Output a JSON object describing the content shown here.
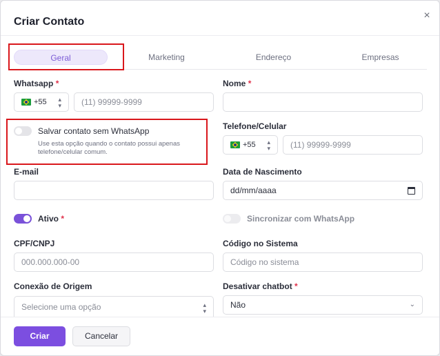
{
  "modal": {
    "title": "Criar Contato",
    "close_icon": "×"
  },
  "tabs": [
    {
      "label": "Geral",
      "active": true
    },
    {
      "label": "Marketing"
    },
    {
      "label": "Endereço"
    },
    {
      "label": "Empresas"
    }
  ],
  "form": {
    "whatsapp": {
      "label": "Whatsapp",
      "required": "*",
      "country_code": "+55",
      "placeholder": "(11) 99999-9999"
    },
    "nome": {
      "label": "Nome",
      "required": "*",
      "value": ""
    },
    "save_without_whatsapp": {
      "label": "Salvar contato sem WhatsApp",
      "help": "Use esta opção quando o contato possui apenas telefone/celular comum.",
      "enabled": false
    },
    "telefone": {
      "label": "Telefone/Celular",
      "country_code": "+55",
      "placeholder": "(11) 99999-9999"
    },
    "email": {
      "label": "E-mail",
      "value": ""
    },
    "nascimento": {
      "label": "Data de Nascimento",
      "placeholder": "dd/mm/aaaa"
    },
    "ativo": {
      "label": "Ativo",
      "required": "*",
      "enabled": true
    },
    "sincronizar": {
      "label": "Sincronizar com WhatsApp",
      "enabled": false
    },
    "cpf": {
      "label": "CPF/CNPJ",
      "placeholder": "000.000.000-00"
    },
    "codigo": {
      "label": "Código no Sistema",
      "placeholder": "Código no sistema"
    },
    "conexao": {
      "label": "Conexão de Origem",
      "placeholder": "Selecione uma opção"
    },
    "chatbot": {
      "label": "Desativar chatbot",
      "required": "*",
      "value": "Não"
    }
  },
  "footer": {
    "create_label": "Criar",
    "cancel_label": "Cancelar"
  },
  "colors": {
    "accent": "#7c4ee0",
    "highlight_box": "#d9161b"
  }
}
